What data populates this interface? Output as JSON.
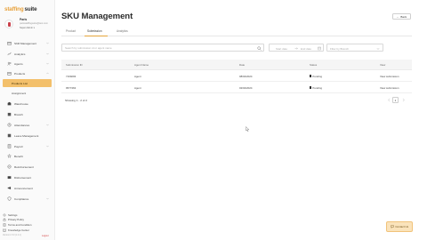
{
  "brand": {
    "part1": "staffing",
    "part2": "suite"
  },
  "profile": {
    "name": "Paris",
    "email": "parisstaffingsuite@test.com",
    "role": "Super Admin"
  },
  "nav": [
    {
      "id": "shift-management",
      "label": "Shift Management",
      "icon": "calendar-icon",
      "chevron": true
    },
    {
      "id": "analytics",
      "label": "Analytics",
      "icon": "chart-icon",
      "chevron": true
    },
    {
      "id": "agents",
      "label": "Agents",
      "icon": "users-icon",
      "chevron": true
    },
    {
      "id": "products",
      "label": "Products",
      "icon": "box-icon",
      "chevron": true,
      "expanded": true
    },
    {
      "id": "products-list",
      "label": "Products List",
      "sub": true,
      "active": true
    },
    {
      "id": "assignment",
      "label": "Assignment",
      "sub": true
    },
    {
      "id": "warehouse",
      "label": "Warehouse",
      "icon": "warehouse-icon"
    },
    {
      "id": "branch",
      "label": "Branch",
      "icon": "branch-icon"
    },
    {
      "id": "attendances",
      "label": "Attendances",
      "icon": "clock-icon",
      "chevron": true
    },
    {
      "id": "leave-management",
      "label": "Leave Management",
      "icon": "leave-icon"
    },
    {
      "id": "payroll",
      "label": "Payroll",
      "icon": "payroll-icon",
      "chevron": true
    },
    {
      "id": "benefit",
      "label": "Benefit",
      "icon": "star-icon"
    },
    {
      "id": "reimbursement",
      "label": "Reimbursement",
      "icon": "reimburse-icon"
    },
    {
      "id": "disbursement",
      "label": "Disbursement",
      "icon": "disburse-icon"
    },
    {
      "id": "announcement",
      "label": "Announcement",
      "icon": "megaphone-icon"
    },
    {
      "id": "compliance",
      "label": "Compliance",
      "icon": "shield-icon",
      "chevron": true
    }
  ],
  "footer": {
    "links": [
      {
        "id": "settings",
        "label": "Settings",
        "icon": "gear-icon"
      },
      {
        "id": "privacy",
        "label": "Privacy Policy",
        "icon": "lock-icon"
      },
      {
        "id": "terms",
        "label": "Terms and Condition",
        "icon": "document-icon"
      },
      {
        "id": "knowledge",
        "label": "Knowledge Center",
        "icon": "book-icon"
      }
    ],
    "version": "Version 1.5.0 (1.2.1)",
    "logout": "Logout"
  },
  "page": {
    "title": "SKU Management",
    "back_label": "Back",
    "tabs": [
      {
        "label": "Product",
        "active": false
      },
      {
        "label": "Submission",
        "active": true
      },
      {
        "label": "Analytics",
        "active": false
      }
    ]
  },
  "filters": {
    "search_placeholder": "Search by submission id or agent name",
    "start_placeholder": "Start date",
    "end_placeholder": "End date",
    "select_placeholder": "Filter by Branch"
  },
  "table": {
    "columns": [
      "Submission ID",
      "Agent Name",
      "Date",
      "Status",
      "View"
    ],
    "rows": [
      {
        "id": "7169293",
        "agent": "Agent",
        "date": "08/02/2024",
        "status": "Pending",
        "view": "View submission"
      },
      {
        "id": "9577463",
        "agent": "Agent",
        "date": "02/02/2024",
        "status": "Pending",
        "view": "View submission"
      }
    ]
  },
  "pagination": {
    "showing": "Showing 1 - 2 of 2",
    "page": "1"
  },
  "contact": {
    "label": "Contact Us"
  },
  "colors": {
    "accent": "#e5a43a",
    "active_bg": "#f3c06b",
    "danger": "#d23b3b"
  }
}
